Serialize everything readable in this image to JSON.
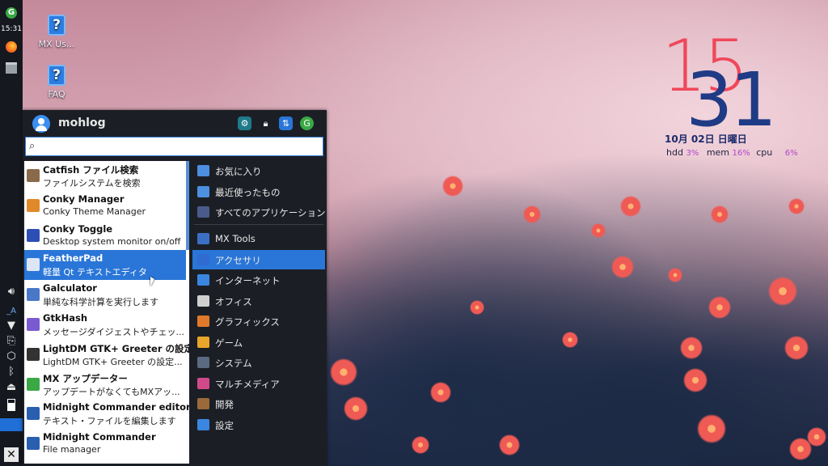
{
  "panel": {
    "time": "15:31",
    "colors": {
      "background": "#15191f",
      "highlight": "#1f6fd6"
    }
  },
  "desktop": {
    "icons": [
      {
        "label": "MX Us...",
        "icon": "help-icon"
      },
      {
        "label": "FAQ",
        "icon": "help-icon"
      }
    ]
  },
  "conky": {
    "hour": "15",
    "minute": "31",
    "date": "10月 02日 日曜日",
    "hdd_label": "hdd",
    "hdd_value": "3%",
    "mem_label": "mem",
    "mem_value": "16%",
    "cpu_label": "cpu",
    "cpu_value": "6%"
  },
  "menu": {
    "username": "mohlog",
    "search": {
      "value": "",
      "placeholder": ""
    },
    "apps": [
      {
        "name": "Catfish ファイル検索",
        "desc": "ファイルシステムを検索",
        "color": "#8a6a4a"
      },
      {
        "name": "Conky Manager",
        "desc": "Conky Theme Manager",
        "color": "#e0892a"
      },
      {
        "name": "Conky Toggle",
        "desc": "Desktop system monitor on/off",
        "color": "#2d4fb5"
      },
      {
        "name": "FeatherPad",
        "desc": "軽量 Qt テキストエディタ",
        "color": "#dde6f5"
      },
      {
        "name": "Galculator",
        "desc": "単純な科学計算を実行します",
        "color": "#4a78c8"
      },
      {
        "name": "GtkHash",
        "desc": "メッセージダイジェストやチェッ...",
        "color": "#7a5ad0"
      },
      {
        "name": "LightDM GTK+ Greeter の設定",
        "desc": "LightDM GTK+ Greeter の設定...",
        "color": "#333333"
      },
      {
        "name": "MX アップデーター",
        "desc": "アップデートがなくてもMXアッ...",
        "color": "#3aa845"
      },
      {
        "name": "Midnight Commander editor",
        "desc": "テキスト・ファイルを編集します",
        "color": "#2a5fb0"
      },
      {
        "name": "Midnight Commander",
        "desc": "File manager",
        "color": "#2a5fb0"
      }
    ],
    "selected_app": 3,
    "categories": [
      {
        "label": "お気に入り",
        "color": "#4d8fe0"
      },
      {
        "label": "最近使ったもの",
        "color": "#4d8fe0"
      },
      {
        "label": "すべてのアプリケーション",
        "color": "#4a5a8a"
      },
      {
        "label": "MX Tools",
        "color": "#3b6fc4"
      },
      {
        "label": "アクセサリ",
        "color": "#2f6bd0"
      },
      {
        "label": "インターネット",
        "color": "#3a86e0"
      },
      {
        "label": "オフィス",
        "color": "#d0d0d0"
      },
      {
        "label": "グラフィックス",
        "color": "#e07a2a"
      },
      {
        "label": "ゲーム",
        "color": "#e8a62a"
      },
      {
        "label": "システム",
        "color": "#5a6a80"
      },
      {
        "label": "マルチメディア",
        "color": "#d04a8a"
      },
      {
        "label": "開発",
        "color": "#9a6a3a"
      },
      {
        "label": "設定",
        "color": "#3a86e0"
      }
    ],
    "selected_category": 4
  }
}
